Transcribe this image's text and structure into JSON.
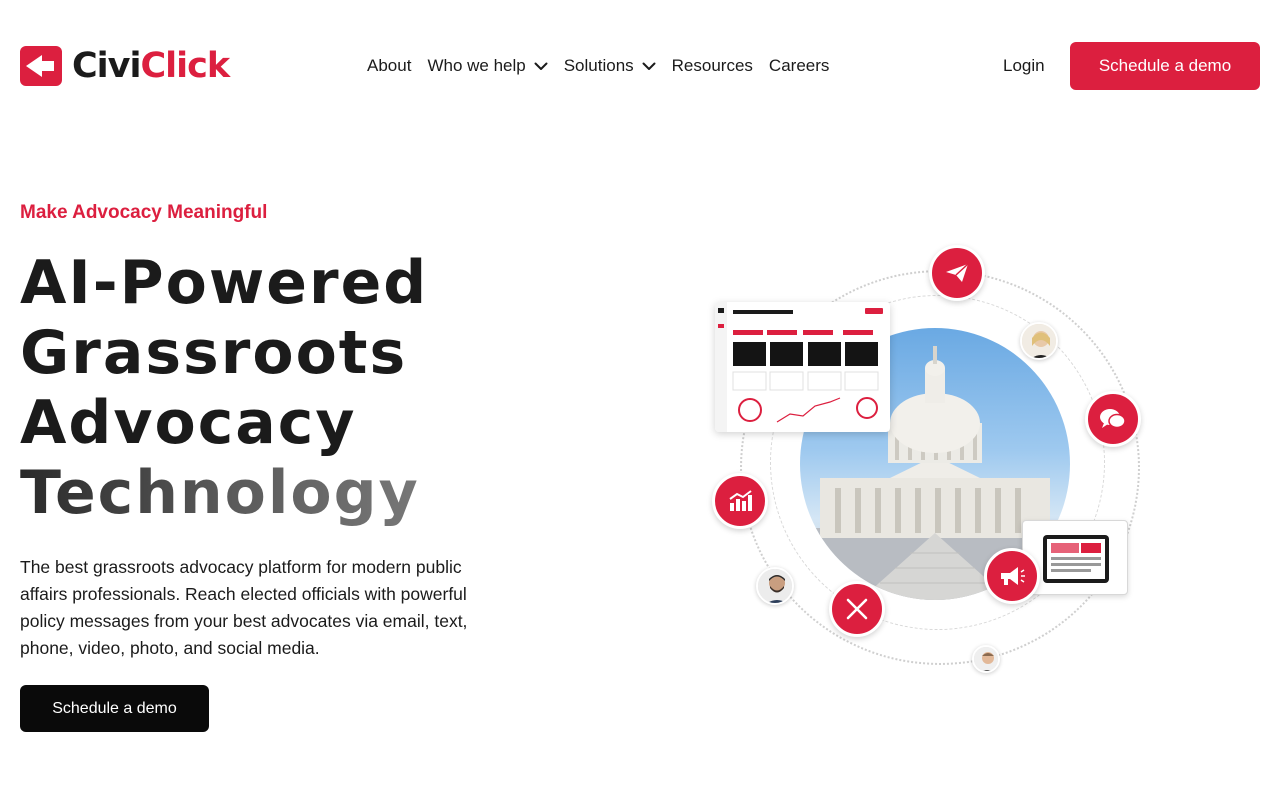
{
  "brand": {
    "name_part1": "Civi",
    "name_part2": "Click",
    "accent_color": "#dc1f3f",
    "dark_color": "#1b1b1b"
  },
  "nav": {
    "items": [
      {
        "label": "About",
        "dropdown": false
      },
      {
        "label": "Who we help",
        "dropdown": true
      },
      {
        "label": "Solutions",
        "dropdown": true
      },
      {
        "label": "Resources",
        "dropdown": false
      },
      {
        "label": "Careers",
        "dropdown": false
      }
    ],
    "login_label": "Login",
    "demo_label": "Schedule a demo"
  },
  "hero": {
    "eyebrow": "Make Advocacy Meaningful",
    "headline_lines": [
      "AI-Powered",
      "Grassroots",
      "Advocacy",
      "Technology"
    ],
    "description": "The best grassroots advocacy platform for modern public affairs professionals. Reach elected officials with powerful policy messages from your best advocates via email, text, phone, video, photo, and social media.",
    "cta_label": "Schedule a demo"
  },
  "illustration": {
    "icons": [
      "paper-plane-icon",
      "chat-bubbles-icon",
      "bar-chart-icon",
      "megaphone-icon",
      "x-logo-icon"
    ]
  }
}
